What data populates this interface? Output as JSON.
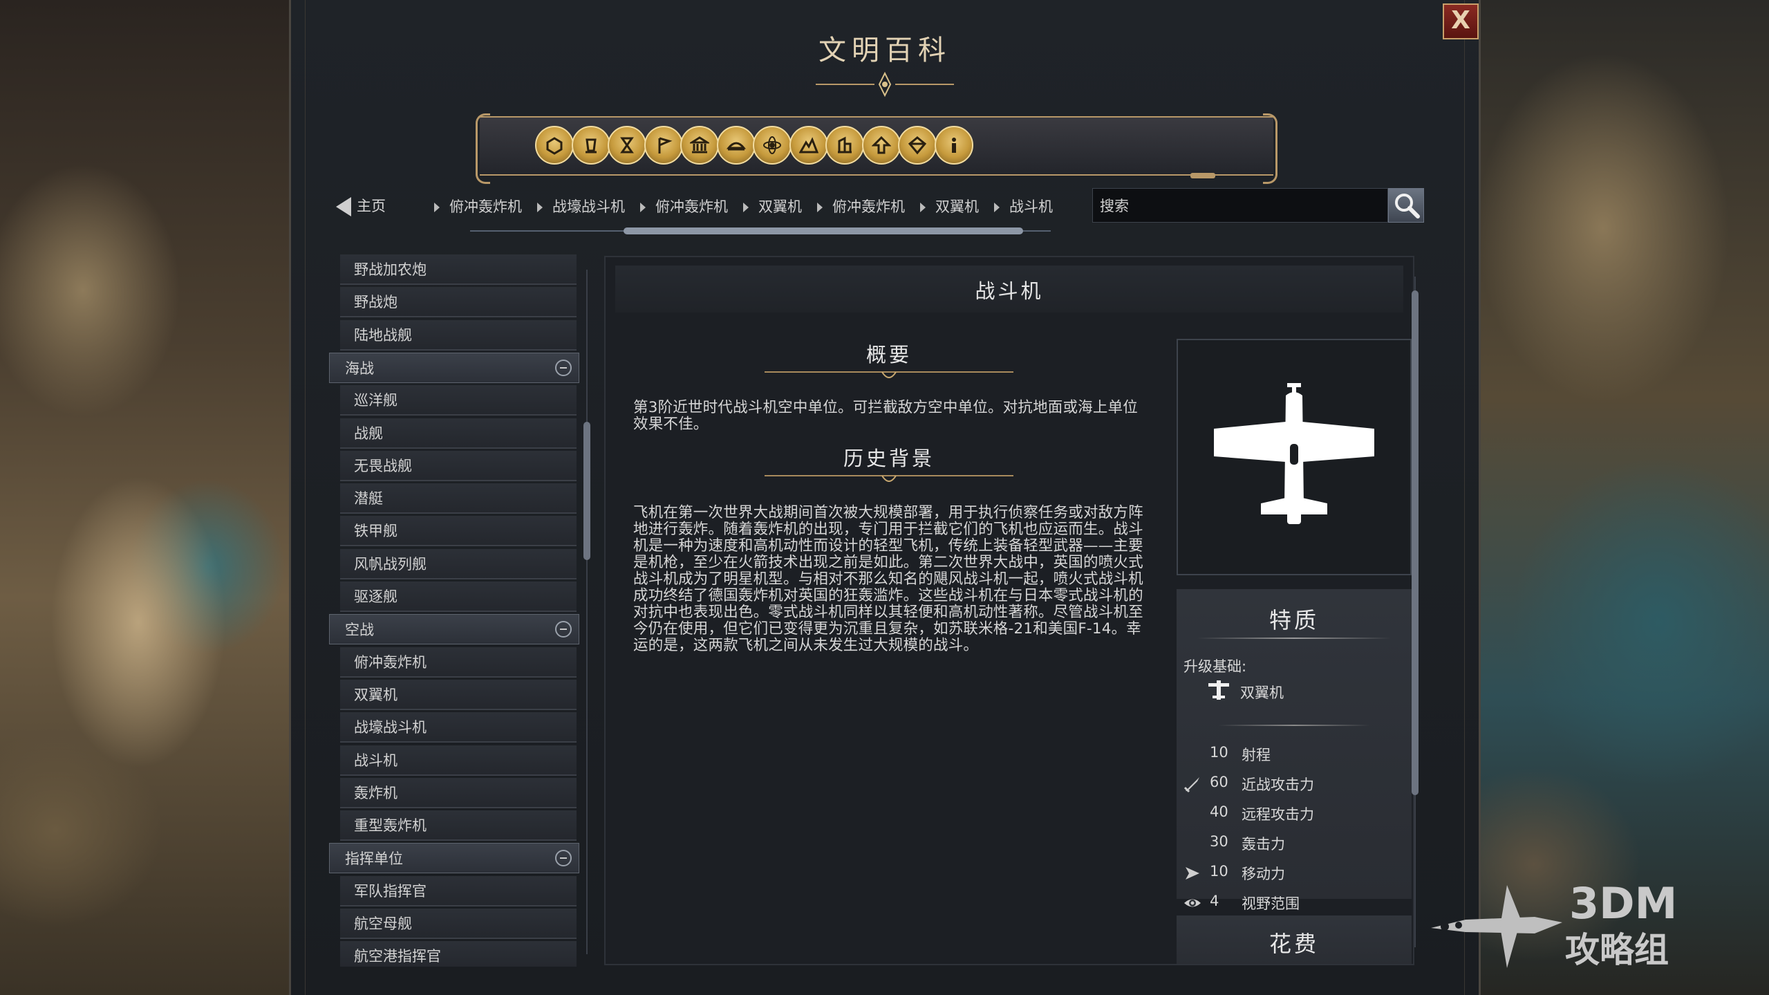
{
  "window": {
    "title": "文明百科",
    "close_label": "X"
  },
  "category_icons": [
    {
      "name": "units-icon"
    },
    {
      "name": "buildings-icon"
    },
    {
      "name": "wonders-icon"
    },
    {
      "name": "civilizations-icon"
    },
    {
      "name": "government-icon"
    },
    {
      "name": "religion-icon"
    },
    {
      "name": "technology-icon"
    },
    {
      "name": "terrain-icon"
    },
    {
      "name": "city-states-icon"
    },
    {
      "name": "promotions-icon"
    },
    {
      "name": "resources-icon"
    },
    {
      "name": "info-icon"
    }
  ],
  "nav": {
    "home_label": "主页",
    "breadcrumbs": [
      "俯冲轰炸机",
      "战壕战斗机",
      "俯冲轰炸机",
      "双翼机",
      "俯冲轰炸机",
      "双翼机",
      "战斗机"
    ],
    "search_placeholder": "搜索"
  },
  "list": [
    {
      "label": "野战加农炮",
      "type": "item"
    },
    {
      "label": "野战炮",
      "type": "item"
    },
    {
      "label": "陆地战舰",
      "type": "item"
    },
    {
      "label": "海战",
      "type": "group"
    },
    {
      "label": "巡洋舰",
      "type": "item"
    },
    {
      "label": "战舰",
      "type": "item"
    },
    {
      "label": "无畏战舰",
      "type": "item"
    },
    {
      "label": "潜艇",
      "type": "item"
    },
    {
      "label": "铁甲舰",
      "type": "item"
    },
    {
      "label": "风帆战列舰",
      "type": "item"
    },
    {
      "label": "驱逐舰",
      "type": "item"
    },
    {
      "label": "空战",
      "type": "group"
    },
    {
      "label": "俯冲轰炸机",
      "type": "item"
    },
    {
      "label": "双翼机",
      "type": "item"
    },
    {
      "label": "战壕战斗机",
      "type": "item"
    },
    {
      "label": "战斗机",
      "type": "item"
    },
    {
      "label": "轰炸机",
      "type": "item"
    },
    {
      "label": "重型轰炸机",
      "type": "item"
    },
    {
      "label": "指挥单位",
      "type": "group"
    },
    {
      "label": "军队指挥官",
      "type": "item"
    },
    {
      "label": "航空母舰",
      "type": "item"
    },
    {
      "label": "航空港指挥官",
      "type": "item"
    }
  ],
  "content": {
    "title": "战斗机",
    "overview_title": "概要",
    "overview_text": "第3阶近世时代战斗机空中单位。可拦截敌方空中单位。对抗地面或海上单位效果不佳。",
    "history_title": "历史背景",
    "history_text": "飞机在第一次世界大战期间首次被大规模部署，用于执行侦察任务或对敌方阵地进行轰炸。随着轰炸机的出现，专门用于拦截它们的飞机也应运而生。战斗机是一种为速度和高机动性而设计的轻型飞机，传统上装备轻型武器——主要是机枪，至少在火箭技术出现之前是如此。第二次世界大战中，英国的喷火式战斗机成为了明星机型。与相对不那么知名的飓风战斗机一起，喷火式战斗机成功终结了德国轰炸机对英国的狂轰滥炸。这些战斗机在与日本零式战斗机的对抗中也表现出色。零式战斗机同样以其轻便和高机动性著称。尽管战斗机至今仍在使用，但它们已变得更为沉重且复杂，如苏联米格-21和美国F-14。幸运的是，这两款飞机之间从未发生过大规模的战斗。",
    "portrait_icon": "fighter-plane-icon"
  },
  "traits": {
    "title": "特质",
    "upgrade_label": "升级基础:",
    "upgrade_unit": "双翼机",
    "stats": [
      {
        "value": "10",
        "label": "射程",
        "icon": ""
      },
      {
        "value": "60",
        "label": "近战攻击力",
        "icon": "sword-icon"
      },
      {
        "value": "40",
        "label": "远程攻击力",
        "icon": ""
      },
      {
        "value": "30",
        "label": "轰击力",
        "icon": ""
      },
      {
        "value": "10",
        "label": "移动力",
        "icon": "movement-icon"
      },
      {
        "value": "4",
        "label": "视野范围",
        "icon": "eye-icon"
      }
    ]
  },
  "cost": {
    "title": "花费"
  },
  "watermark": {
    "line1": "3DM",
    "line2": "攻略组"
  }
}
